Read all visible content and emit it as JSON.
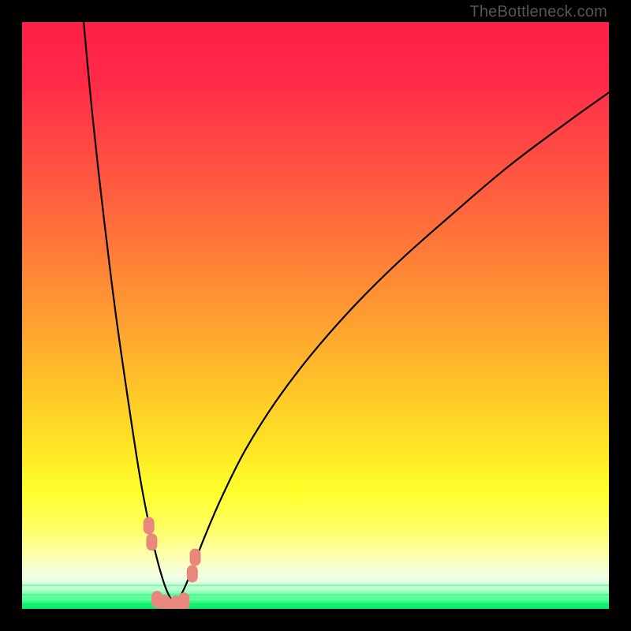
{
  "watermark": "TheBottleneck.com",
  "colors": {
    "frame": "#000000",
    "curve": "#000000",
    "marker_fill": "#e8877c",
    "gradient_stops": [
      {
        "offset": 0.0,
        "color": "#ff1f47"
      },
      {
        "offset": 0.1,
        "color": "#ff2a49"
      },
      {
        "offset": 0.22,
        "color": "#ff4b43"
      },
      {
        "offset": 0.35,
        "color": "#ff6f3b"
      },
      {
        "offset": 0.48,
        "color": "#ff9632"
      },
      {
        "offset": 0.6,
        "color": "#ffbd2a"
      },
      {
        "offset": 0.72,
        "color": "#ffe425"
      },
      {
        "offset": 0.8,
        "color": "#ffff2b"
      },
      {
        "offset": 0.86,
        "color": "#ffff60"
      },
      {
        "offset": 0.91,
        "color": "#fdffb0"
      },
      {
        "offset": 0.945,
        "color": "#f3ffe8"
      },
      {
        "offset": 0.965,
        "color": "#b8ffce"
      },
      {
        "offset": 0.985,
        "color": "#3dff8a"
      },
      {
        "offset": 1.0,
        "color": "#00e768"
      }
    ]
  },
  "chart_data": {
    "type": "line",
    "title": "",
    "xlabel": "",
    "ylabel": "",
    "xlim": [
      0,
      100
    ],
    "ylim": [
      0,
      100
    ],
    "grid": false,
    "legend": false,
    "minimum_at_x": 26,
    "series": [
      {
        "name": "left-branch",
        "x": [
          10.5,
          12,
          14,
          16,
          18,
          20,
          21.5,
          23,
          24.5,
          26
        ],
        "values": [
          100,
          84,
          66,
          50,
          36,
          23,
          15,
          8.5,
          3.5,
          0.6
        ]
      },
      {
        "name": "right-branch",
        "x": [
          26,
          27.5,
          29,
          31,
          34,
          38,
          43,
          49,
          56,
          64,
          73,
          83,
          93,
          100
        ],
        "values": [
          0.6,
          3.2,
          6.8,
          12,
          19,
          27,
          35,
          43,
          51,
          59,
          67,
          75.5,
          83,
          88
        ]
      }
    ],
    "markers": [
      {
        "x": 21.6,
        "y": 14.2
      },
      {
        "x": 22.1,
        "y": 11.4
      },
      {
        "x": 23.0,
        "y": 1.6
      },
      {
        "x": 24.4,
        "y": 0.9
      },
      {
        "x": 26.2,
        "y": 0.8
      },
      {
        "x": 27.6,
        "y": 1.3
      },
      {
        "x": 29.0,
        "y": 6.0
      },
      {
        "x": 29.5,
        "y": 8.8
      }
    ],
    "green_bands_y": [
      0.8,
      1.6,
      2.4,
      3.2,
      4.0,
      4.8
    ]
  }
}
